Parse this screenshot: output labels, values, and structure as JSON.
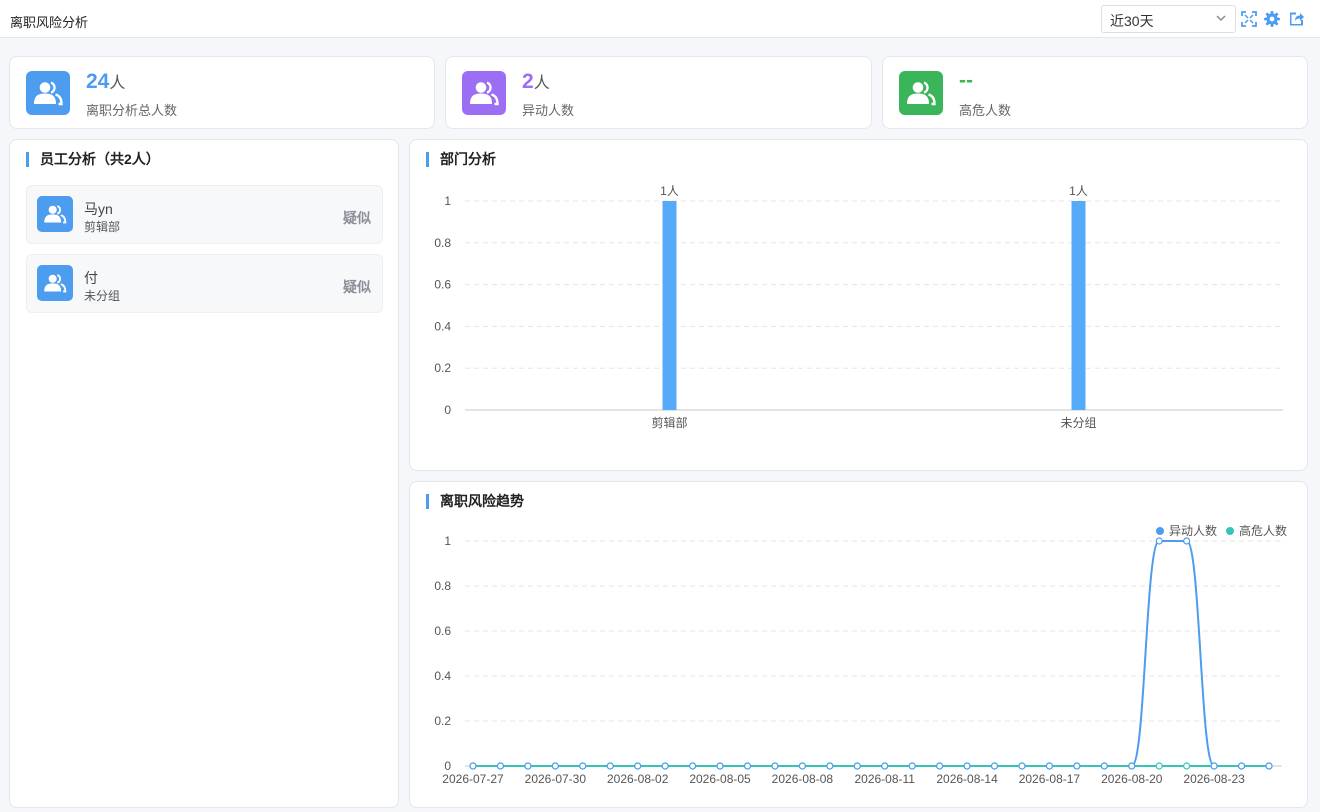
{
  "app": {
    "title": "离职风险分析"
  },
  "toolbar": {
    "period_value": "近30天",
    "fullscreen_icon": "fullscreen-icon",
    "settings_icon": "gear-icon",
    "export_icon": "export-icon",
    "accent": "#4c9cf0"
  },
  "stats": [
    {
      "value": "24",
      "unit": "人",
      "label": "离职分析总人数",
      "color": "#4c9cf0",
      "icon": "users-icon"
    },
    {
      "value": "2",
      "unit": "人",
      "label": "异动人数",
      "color": "#9b6ef3",
      "icon": "users-icon"
    },
    {
      "value": "--",
      "unit": "",
      "label": "高危人数",
      "color": "#3bb55a",
      "icon": "users-icon"
    }
  ],
  "employee_panel": {
    "title": "员工分析（共2人）",
    "items": [
      {
        "name": "马yn",
        "dept": "剪辑部",
        "status": "疑似"
      },
      {
        "name": "付",
        "dept": "未分组",
        "status": "疑似"
      }
    ]
  },
  "dept_panel": {
    "title": "部门分析"
  },
  "trend_panel": {
    "title": "离职风险趋势"
  },
  "chart_data": [
    {
      "type": "bar",
      "title": "部门分析",
      "categories": [
        "剪辑部",
        "未分组"
      ],
      "values": [
        1,
        1
      ],
      "data_labels": [
        "1人",
        "1人"
      ],
      "ylim": [
        0,
        1
      ],
      "yticks": [
        "0",
        "0.2",
        "0.4",
        "0.6",
        "0.8",
        "1"
      ],
      "grid": true,
      "color": "#55abfa"
    },
    {
      "type": "line",
      "title": "离职风险趋势",
      "x": [
        "2026-07-27",
        "2026-07-28",
        "2026-07-29",
        "2026-07-30",
        "2026-07-31",
        "2026-08-01",
        "2026-08-02",
        "2026-08-03",
        "2026-08-04",
        "2026-08-05",
        "2026-08-06",
        "2026-08-07",
        "2026-08-08",
        "2026-08-09",
        "2026-08-10",
        "2026-08-11",
        "2026-08-12",
        "2026-08-13",
        "2026-08-14",
        "2026-08-15",
        "2026-08-16",
        "2026-08-17",
        "2026-08-18",
        "2026-08-19",
        "2026-08-20",
        "2026-08-21",
        "2026-08-22",
        "2026-08-23",
        "2026-08-24",
        "2026-08-25"
      ],
      "xticks": [
        "2026-07-27",
        "2026-07-30",
        "2026-08-02",
        "2026-08-05",
        "2026-08-08",
        "2026-08-11",
        "2026-08-14",
        "2026-08-17",
        "2026-08-20",
        "2026-08-23"
      ],
      "series": [
        {
          "name": "异动人数",
          "color": "#4c9cf0",
          "values": [
            0,
            0,
            0,
            0,
            0,
            0,
            0,
            0,
            0,
            0,
            0,
            0,
            0,
            0,
            0,
            0,
            0,
            0,
            0,
            0,
            0,
            0,
            0,
            0,
            0,
            1,
            1,
            0,
            0,
            0
          ]
        },
        {
          "name": "高危人数",
          "color": "#36c4b8",
          "values": [
            0,
            0,
            0,
            0,
            0,
            0,
            0,
            0,
            0,
            0,
            0,
            0,
            0,
            0,
            0,
            0,
            0,
            0,
            0,
            0,
            0,
            0,
            0,
            0,
            0,
            0,
            0,
            0,
            0,
            0
          ]
        }
      ],
      "ylim": [
        0,
        1
      ],
      "yticks": [
        "0",
        "0.2",
        "0.4",
        "0.6",
        "0.8",
        "1"
      ],
      "grid": true,
      "legend": "top-right"
    }
  ]
}
